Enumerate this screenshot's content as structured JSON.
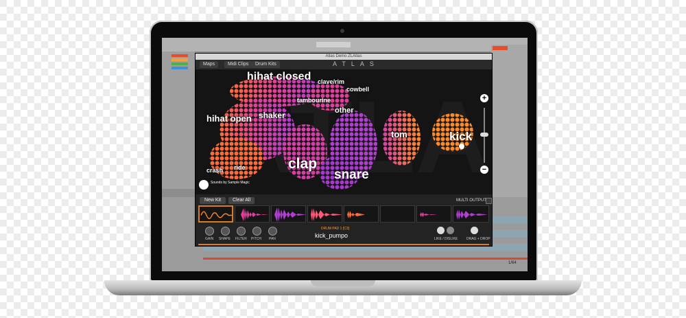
{
  "plugin": {
    "window_title": "Atlas Demo ZLAtlas",
    "brand": "ATLAS",
    "tabs": [
      "Maps",
      "Midi Clips",
      "Drum Kits"
    ],
    "map_labels": {
      "hihat_closed": "hihat closed",
      "clave_rim": "clave/rim",
      "cowbell": "cowbell",
      "tambourine": "tambourine",
      "other": "other",
      "hihat_open": "hihat open",
      "shaker": "shaker",
      "tom": "tom",
      "kick": "kick",
      "crash": "crash",
      "ride": "ride",
      "clap": "clap",
      "snare": "snare"
    },
    "zoom": {
      "plus": "+",
      "minus": "−"
    },
    "logo_text": "Sounds by Sample Magic",
    "buttons": {
      "new_kit": "New Kit",
      "clear_all": "Clear All"
    },
    "multi_output": "MULTI OUTPUT",
    "knobs": [
      "GAIN",
      "SHAPE",
      "FILTER",
      "PITCH",
      "PAN"
    ],
    "drum_pad": "DRUM PAD 1 [C3]",
    "sample_name": "kick_pumpo",
    "like_dislike": "LIKE / DISLIKE",
    "drag_drop": "DRAG + DROP"
  },
  "daw": {
    "bottom_label": "1/64"
  }
}
